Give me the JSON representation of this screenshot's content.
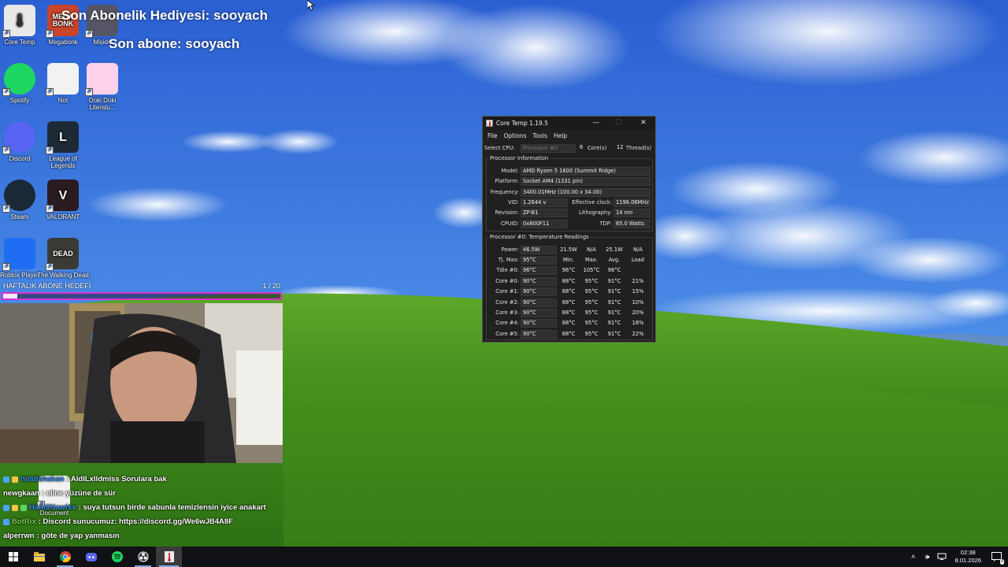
{
  "desktop": {
    "icons": [
      {
        "label": "Core Temp",
        "color": "#e9e9e9",
        "glyph": "🌡"
      },
      {
        "label": "Megabonk",
        "color": "#c8442c",
        "glyph": "MEGA BONK"
      },
      {
        "label": "Mișide",
        "color": "#555566",
        "glyph": ""
      },
      {
        "label": "Spotify",
        "color": "#1ed760",
        "glyph": ""
      },
      {
        "label": "Not",
        "color": "#f2f2f2",
        "glyph": ""
      },
      {
        "label": "Doki Doki Literatu...",
        "color": "#ffd1ea",
        "glyph": ""
      },
      {
        "label": "Discord",
        "color": "#5865f2",
        "glyph": ""
      },
      {
        "label": "League of Legends",
        "color": "#1d2a36",
        "glyph": "L"
      },
      {
        "label": "Steam",
        "color": "#1b2838",
        "glyph": ""
      },
      {
        "label": "VALORANT",
        "color": "#2a1a22",
        "glyph": "V"
      },
      {
        "label": "Roblox Player",
        "color": "#1f6df2",
        "glyph": ""
      },
      {
        "label": "The Walking Dead",
        "color": "#3b3a35",
        "glyph": "DEAD"
      },
      {
        "label": "Document",
        "color": "#f2f2f2",
        "glyph": ""
      }
    ]
  },
  "overlay": {
    "last_gift": "Son Abonelik Hediyesi: sooyach",
    "last_sub": "Son abone: sooyach",
    "goal_title": "HAFTALIK ABONE HEDEFİ",
    "goal_count": "1 / 20",
    "goal_progress": 0.05,
    "goal_color": "#d535c8"
  },
  "chat": [
    {
      "user": "hiddishakan",
      "user_color": "#3a8df0",
      "message": ": AldILxlldmlss Sorulara bak",
      "badges": 2
    },
    {
      "user": "newgkaan",
      "user_color": "#ffffff",
      "message": ": eline yüzüne de sür",
      "badges": 0
    },
    {
      "user": "HaddiNawfxx",
      "user_color": "#3a8df0",
      "message": ": suya tutsun birde sabunla temizlensin iyice anakart",
      "badges": 3
    },
    {
      "user": "BotRix",
      "user_color": "#7dd95c",
      "message": ": Discord sunucumuz: https://discord.gg/We6wJB4A8F",
      "badges": 1
    },
    {
      "user": "alperrwn",
      "user_color": "#ffffff",
      "message": ": göte de yap yanmasın",
      "badges": 0
    }
  ],
  "coretemp": {
    "title": "Core Temp 1.19.5",
    "menu": [
      "File",
      "Options",
      "Tools",
      "Help"
    ],
    "select_cpu_label": "Select CPU:",
    "select_cpu_value": "Processor #0",
    "cores_count": "6",
    "cores_label": "Core(s)",
    "threads_count": "12",
    "threads_label": "Thread(s)",
    "processor_info_title": "Processor Information",
    "model_label": "Model:",
    "model": "AMD Ryzen 5 1600 (Summit Ridge)",
    "platform_label": "Platform:",
    "platform": "Socket AM4 (1331 pin)",
    "frequency_label": "Frequency:",
    "frequency": "3400.01MHz (100.00 x 34.00)",
    "vid_label": "VID:",
    "vid": "1.2644 v",
    "eff_clock_label": "Effective clock:",
    "eff_clock": "1196.06MHz",
    "revision_label": "Revision:",
    "revision": "ZP-B1",
    "litho_label": "Lithography:",
    "litho": "14 nm",
    "cpuid_label": "CPUID:",
    "cpuid": "0x800F11",
    "tdp_label": "TDP:",
    "tdp": "65.0 Watts",
    "temp_title": "Processor #0: Temperature Readings",
    "power_label": "Power:",
    "power": [
      "46.5W",
      "21.5W",
      "N/A",
      "25.1W",
      "N/A"
    ],
    "tjmax_label": "Tj. Max:",
    "tjmax": "95°C",
    "col_min": "Min.",
    "col_max": "Max.",
    "col_avg": "Avg.",
    "col_load": "Load",
    "tdie_label": "Tdie #0:",
    "tdie": [
      "96°C",
      "96°C",
      "105°C",
      "96°C"
    ],
    "cores": [
      {
        "label": "Core #0:",
        "temp": "90°C",
        "min": "88°C",
        "max": "95°C",
        "avg": "91°C",
        "load": "21%"
      },
      {
        "label": "Core #1:",
        "temp": "90°C",
        "min": "88°C",
        "max": "95°C",
        "avg": "91°C",
        "load": "15%"
      },
      {
        "label": "Core #2:",
        "temp": "90°C",
        "min": "88°C",
        "max": "95°C",
        "avg": "91°C",
        "load": "10%"
      },
      {
        "label": "Core #3:",
        "temp": "90°C",
        "min": "88°C",
        "max": "95°C",
        "avg": "91°C",
        "load": "20%"
      },
      {
        "label": "Core #4:",
        "temp": "90°C",
        "min": "88°C",
        "max": "95°C",
        "avg": "91°C",
        "load": "18%"
      },
      {
        "label": "Core #5:",
        "temp": "90°C",
        "min": "88°C",
        "max": "95°C",
        "avg": "91°C",
        "load": "22%"
      }
    ]
  },
  "taskbar": {
    "apps": [
      "start-icon",
      "file-explorer-icon",
      "chrome-icon",
      "discord-icon",
      "spotify-icon",
      "obs-icon",
      "core-temp-icon"
    ],
    "time": "02:38",
    "date": "8.01.2026",
    "notification_count": "3"
  }
}
